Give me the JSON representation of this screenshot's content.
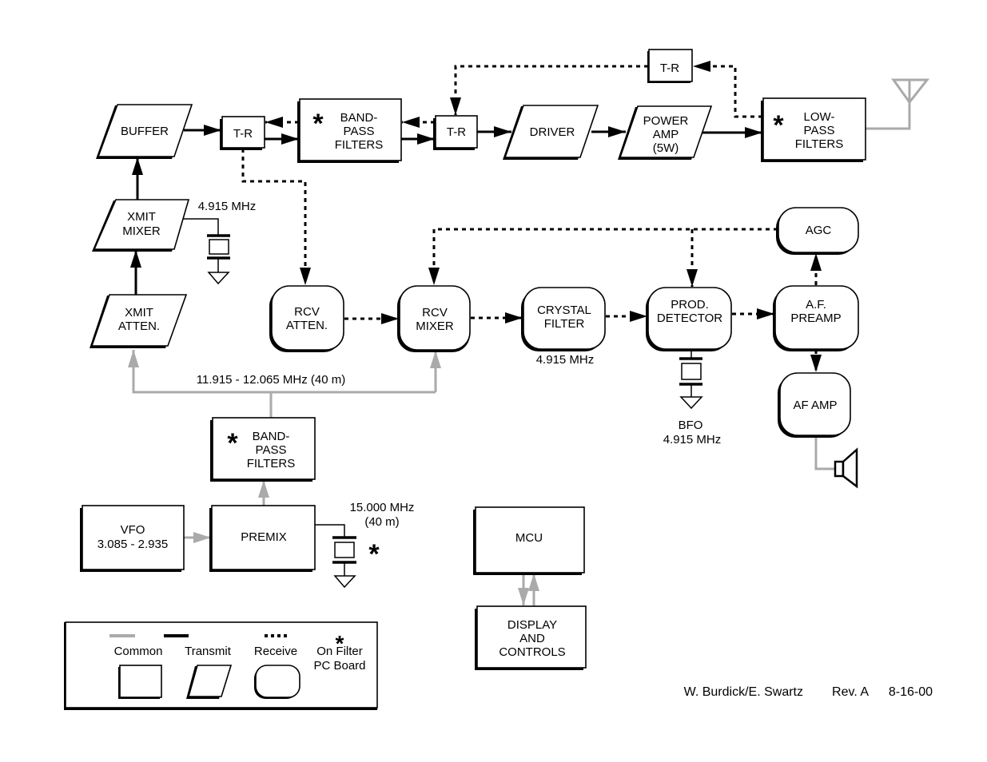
{
  "blocks": {
    "buffer": [
      "BUFFER"
    ],
    "tr_left": [
      "T-R"
    ],
    "bpf_top": [
      "BAND-",
      "PASS",
      "FILTERS"
    ],
    "tr_mid": [
      "T-R"
    ],
    "driver": [
      "DRIVER"
    ],
    "power_amp": [
      "POWER",
      "AMP",
      "(5W)"
    ],
    "tr_top": [
      "T-R"
    ],
    "lpf": [
      "LOW-",
      "PASS",
      "FILTERS"
    ],
    "xmit_mixer": [
      "XMIT",
      "MIXER"
    ],
    "xmit_atten": [
      "XMIT",
      "ATTEN."
    ],
    "rcv_atten": [
      "RCV",
      "ATTEN."
    ],
    "rcv_mixer": [
      "RCV",
      "MIXER"
    ],
    "crystal_filter": [
      "CRYSTAL",
      "FILTER"
    ],
    "prod_detector": [
      "PROD.",
      "DETECTOR"
    ],
    "af_preamp": [
      "A.F.",
      "PREAMP"
    ],
    "agc": [
      "AGC"
    ],
    "af_amp": [
      "AF AMP"
    ],
    "bpf_low": [
      "BAND-",
      "PASS",
      "FILTERS"
    ],
    "vfo": [
      "VFO",
      "3.085 - 2.935"
    ],
    "premix": [
      "PREMIX"
    ],
    "mcu": [
      "MCU"
    ],
    "display": [
      "DISPLAY",
      "AND",
      "CONTROLS"
    ]
  },
  "labels": {
    "xmit_xtal": "4.915 MHz",
    "premix_out": "11.915 - 12.065 MHz (40 m)",
    "crystal_freq": "4.915 MHz",
    "bfo": [
      "BFO",
      "4.915 MHz"
    ],
    "premix_xtal": [
      "15.000 MHz",
      "(40 m)"
    ],
    "asterisk": "*"
  },
  "legend": {
    "common": "Common",
    "transmit": "Transmit",
    "receive": "Receive",
    "filter_board": [
      "On Filter",
      "PC Board"
    ],
    "colors": {
      "common": "#aaaaaa",
      "transmit": "#000000",
      "receive": "#000000"
    }
  },
  "credit": {
    "authors": "W. Burdick/E. Swartz",
    "revision": "Rev. A",
    "date": "8-16-00"
  }
}
